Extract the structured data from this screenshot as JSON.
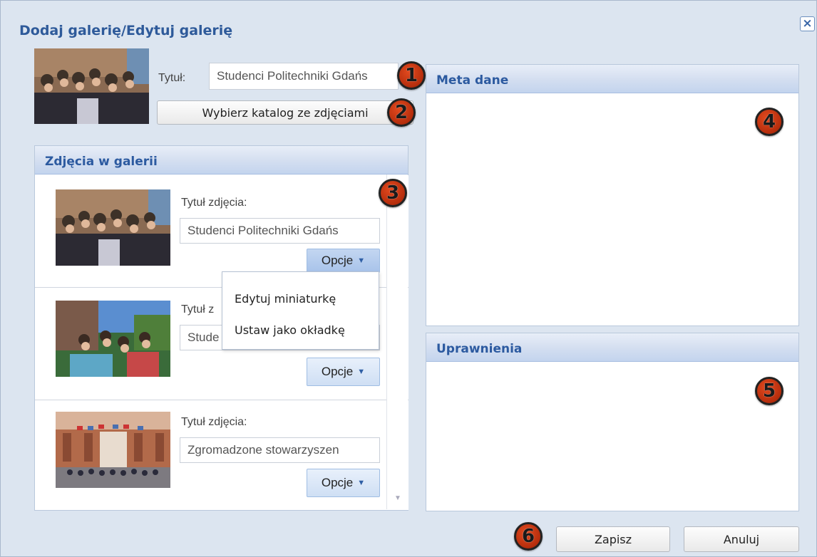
{
  "dialog": {
    "title": "Dodaj galerię/Edytuj galerię",
    "close_label": "×"
  },
  "form": {
    "title_label": "Tytuł:",
    "title_value": "Studenci Politechniki Gdańs",
    "choose_folder_label": "Wybierz katalog ze zdjęciami"
  },
  "gallery": {
    "header": "Zdjęcia w galerii",
    "photos": [
      {
        "title_label": "Tytuł zdjęcia:",
        "title_value": "Studenci Politechniki Gdańs",
        "options_label": "Opcje"
      },
      {
        "title_label": "Tytuł z",
        "title_value": "Stude",
        "options_label": "Opcje"
      },
      {
        "title_label": "Tytuł zdjęcia:",
        "title_value": "Zgromadzone stowarzyszen",
        "options_label": "Opcje"
      }
    ]
  },
  "dropdown": {
    "items": [
      "Edytuj miniaturkę",
      "Ustaw jako okładkę"
    ]
  },
  "meta": {
    "header": "Meta dane"
  },
  "permissions": {
    "header": "Uprawnienia"
  },
  "actions": {
    "save_label": "Zapisz",
    "cancel_label": "Anuluj"
  },
  "markers": [
    "1",
    "2",
    "3",
    "4",
    "5",
    "6"
  ],
  "colors": {
    "accent": "#2e5a9a",
    "marker": "#c0340f",
    "panel_header": "#d3def0"
  }
}
